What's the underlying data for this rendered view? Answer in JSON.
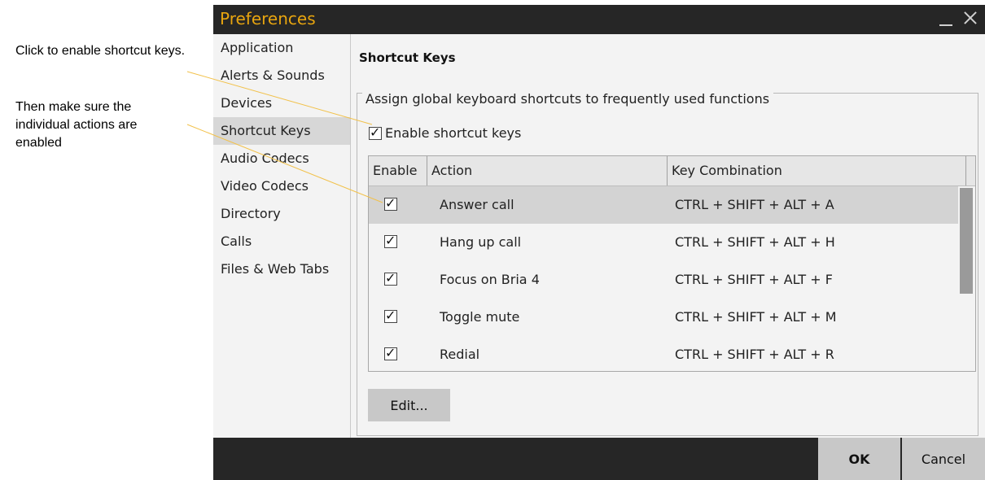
{
  "annotations": {
    "enable_note": "Click to enable shortcut keys.",
    "actions_note": "Then make sure the individual actions are enabled"
  },
  "window": {
    "title": "Preferences",
    "title_color": "#e8a50f",
    "minimize_icon": "minimize-icon",
    "close_icon": "close-icon"
  },
  "sidebar": {
    "items": [
      {
        "label": "Application"
      },
      {
        "label": "Alerts & Sounds"
      },
      {
        "label": "Devices"
      },
      {
        "label": "Shortcut Keys",
        "selected": true
      },
      {
        "label": "Audio Codecs"
      },
      {
        "label": "Video Codecs"
      },
      {
        "label": "Directory"
      },
      {
        "label": "Calls"
      },
      {
        "label": "Files & Web Tabs"
      }
    ]
  },
  "main": {
    "page_title": "Shortcut Keys",
    "group_title": "Assign global keyboard shortcuts to frequently used functions",
    "enable_label": "Enable shortcut keys",
    "enable_checked": true,
    "table": {
      "headers": [
        "Enable",
        "Action",
        "Key Combination"
      ],
      "rows": [
        {
          "enabled": true,
          "action": "Answer call",
          "keys": "CTRL + SHIFT + ALT + A",
          "selected": true
        },
        {
          "enabled": true,
          "action": "Hang up call",
          "keys": "CTRL + SHIFT + ALT + H"
        },
        {
          "enabled": true,
          "action": "Focus on Bria 4",
          "keys": "CTRL + SHIFT + ALT + F"
        },
        {
          "enabled": true,
          "action": "Toggle mute",
          "keys": "CTRL + SHIFT + ALT + M"
        },
        {
          "enabled": true,
          "action": "Redial",
          "keys": "CTRL + SHIFT + ALT + R"
        }
      ]
    },
    "edit_label": "Edit..."
  },
  "footer": {
    "ok_label": "OK",
    "cancel_label": "Cancel"
  }
}
